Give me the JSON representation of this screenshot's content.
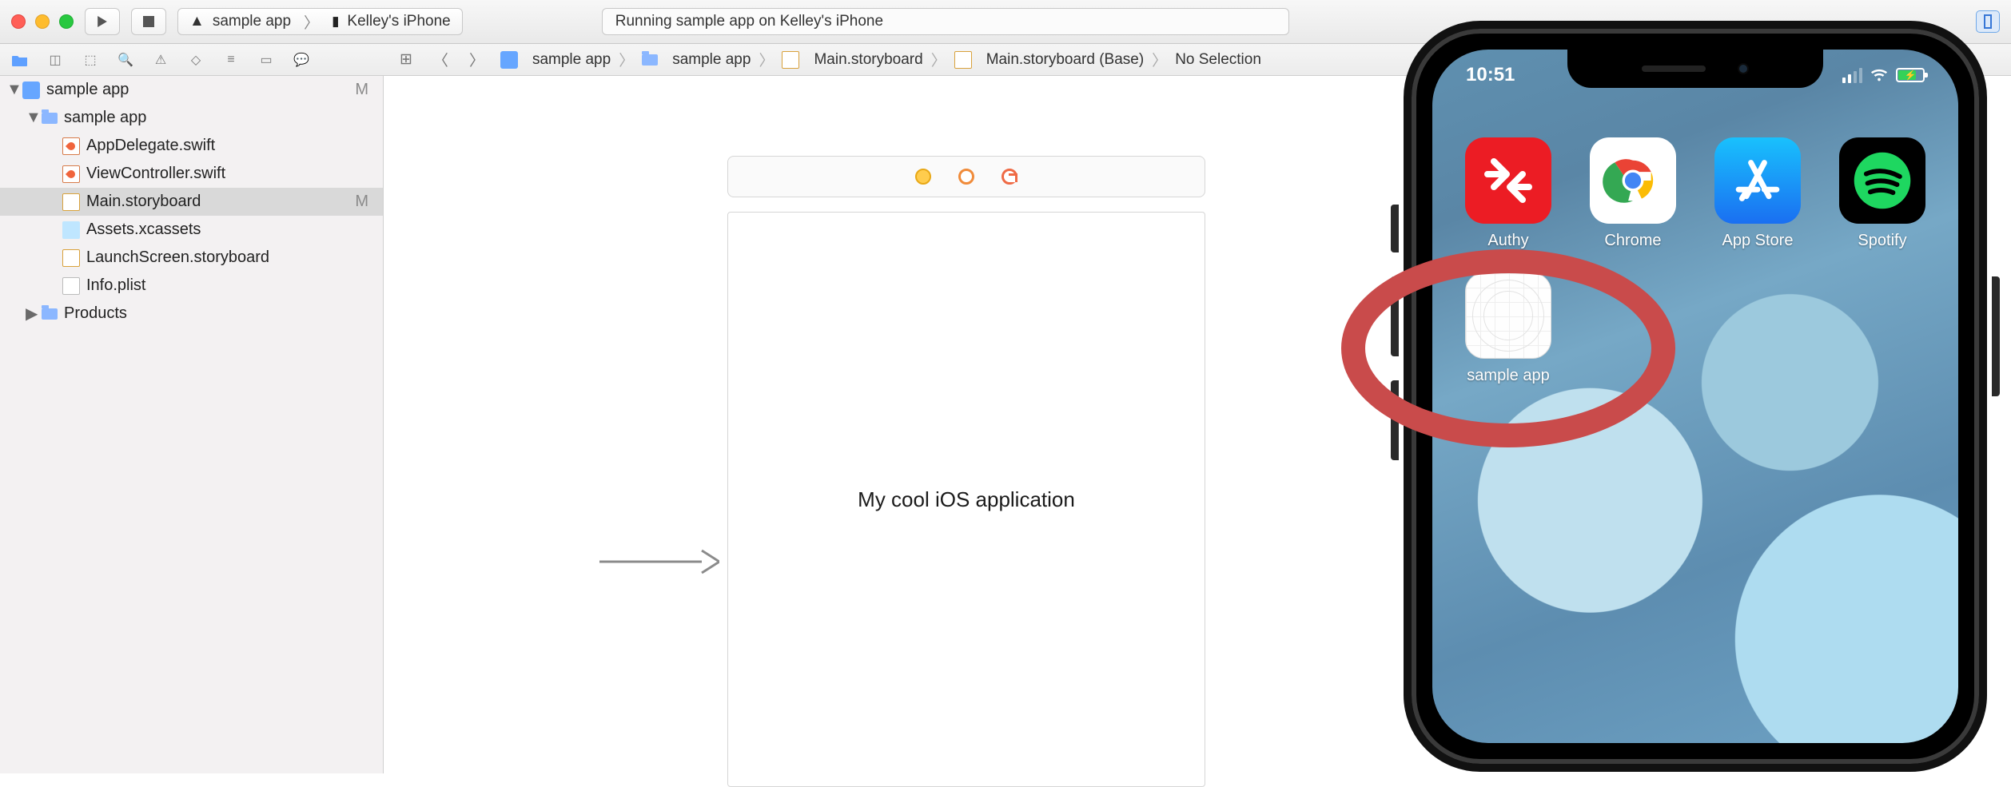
{
  "toolbar": {
    "scheme_target": "sample app",
    "scheme_device": "Kelley's iPhone",
    "status_text": "Running sample app on Kelley's iPhone"
  },
  "breadcrumb": {
    "items": [
      "sample app",
      "sample app",
      "Main.storyboard",
      "Main.storyboard (Base)",
      "No Selection"
    ]
  },
  "navigator": {
    "root": {
      "name": "sample app",
      "m": "M"
    },
    "group": {
      "name": "sample app"
    },
    "files": [
      {
        "name": "AppDelegate.swift",
        "kind": "swift"
      },
      {
        "name": "ViewController.swift",
        "kind": "swift"
      },
      {
        "name": "Main.storyboard",
        "kind": "sb",
        "m": "M",
        "selected": true
      },
      {
        "name": "Assets.xcassets",
        "kind": "assets"
      },
      {
        "name": "LaunchScreen.storyboard",
        "kind": "sb"
      },
      {
        "name": "Info.plist",
        "kind": "plist"
      }
    ],
    "products": {
      "name": "Products"
    }
  },
  "storyboard": {
    "label_text": "My cool iOS application"
  },
  "phone": {
    "time": "10:51",
    "apps_row1": [
      {
        "name": "Authy",
        "icon": "authy"
      },
      {
        "name": "Chrome",
        "icon": "chrome"
      },
      {
        "name": "App Store",
        "icon": "appstore"
      },
      {
        "name": "Spotify",
        "icon": "spotify"
      }
    ],
    "apps_row2": [
      {
        "name": "sample app",
        "icon": "sample"
      }
    ]
  }
}
